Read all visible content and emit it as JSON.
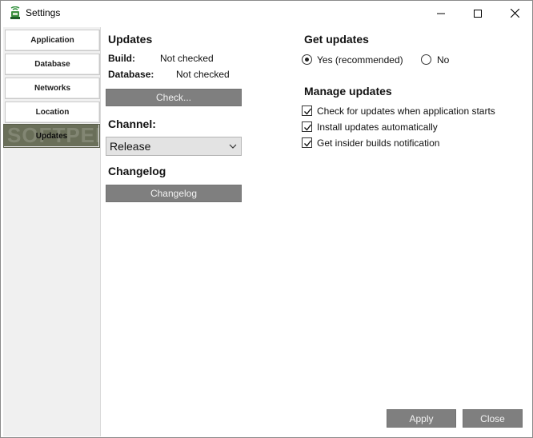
{
  "window": {
    "title": "Settings",
    "app_icon": "satellite-dish-icon"
  },
  "sidebar": {
    "items": [
      {
        "label": "Application",
        "active": false
      },
      {
        "label": "Database",
        "active": false
      },
      {
        "label": "Networks",
        "active": false
      },
      {
        "label": "Location",
        "active": false
      },
      {
        "label": "Updates",
        "active": true
      }
    ],
    "watermark": "SOFTPEDIA",
    "active_color": "#6a6f59"
  },
  "updates": {
    "heading": "Updates",
    "build_label": "Build:",
    "build_value": "Not checked",
    "database_label": "Database:",
    "database_value": "Not checked",
    "check_button": "Check..."
  },
  "channel": {
    "heading": "Channel:",
    "selected": "Release"
  },
  "changelog": {
    "heading": "Changelog",
    "button": "Changelog"
  },
  "get_updates": {
    "heading": "Get updates",
    "yes_label": "Yes (recommended)",
    "no_label": "No",
    "selected": "yes"
  },
  "manage_updates": {
    "heading": "Manage updates",
    "options": [
      {
        "label": "Check for updates when application starts",
        "checked": true
      },
      {
        "label": "Install updates automatically",
        "checked": true
      },
      {
        "label": "Get insider builds notification",
        "checked": true
      }
    ]
  },
  "footer": {
    "apply": "Apply",
    "close": "Close"
  },
  "colors": {
    "button_gray": "#7f7f7f",
    "button_text": "#f2f2f2"
  }
}
